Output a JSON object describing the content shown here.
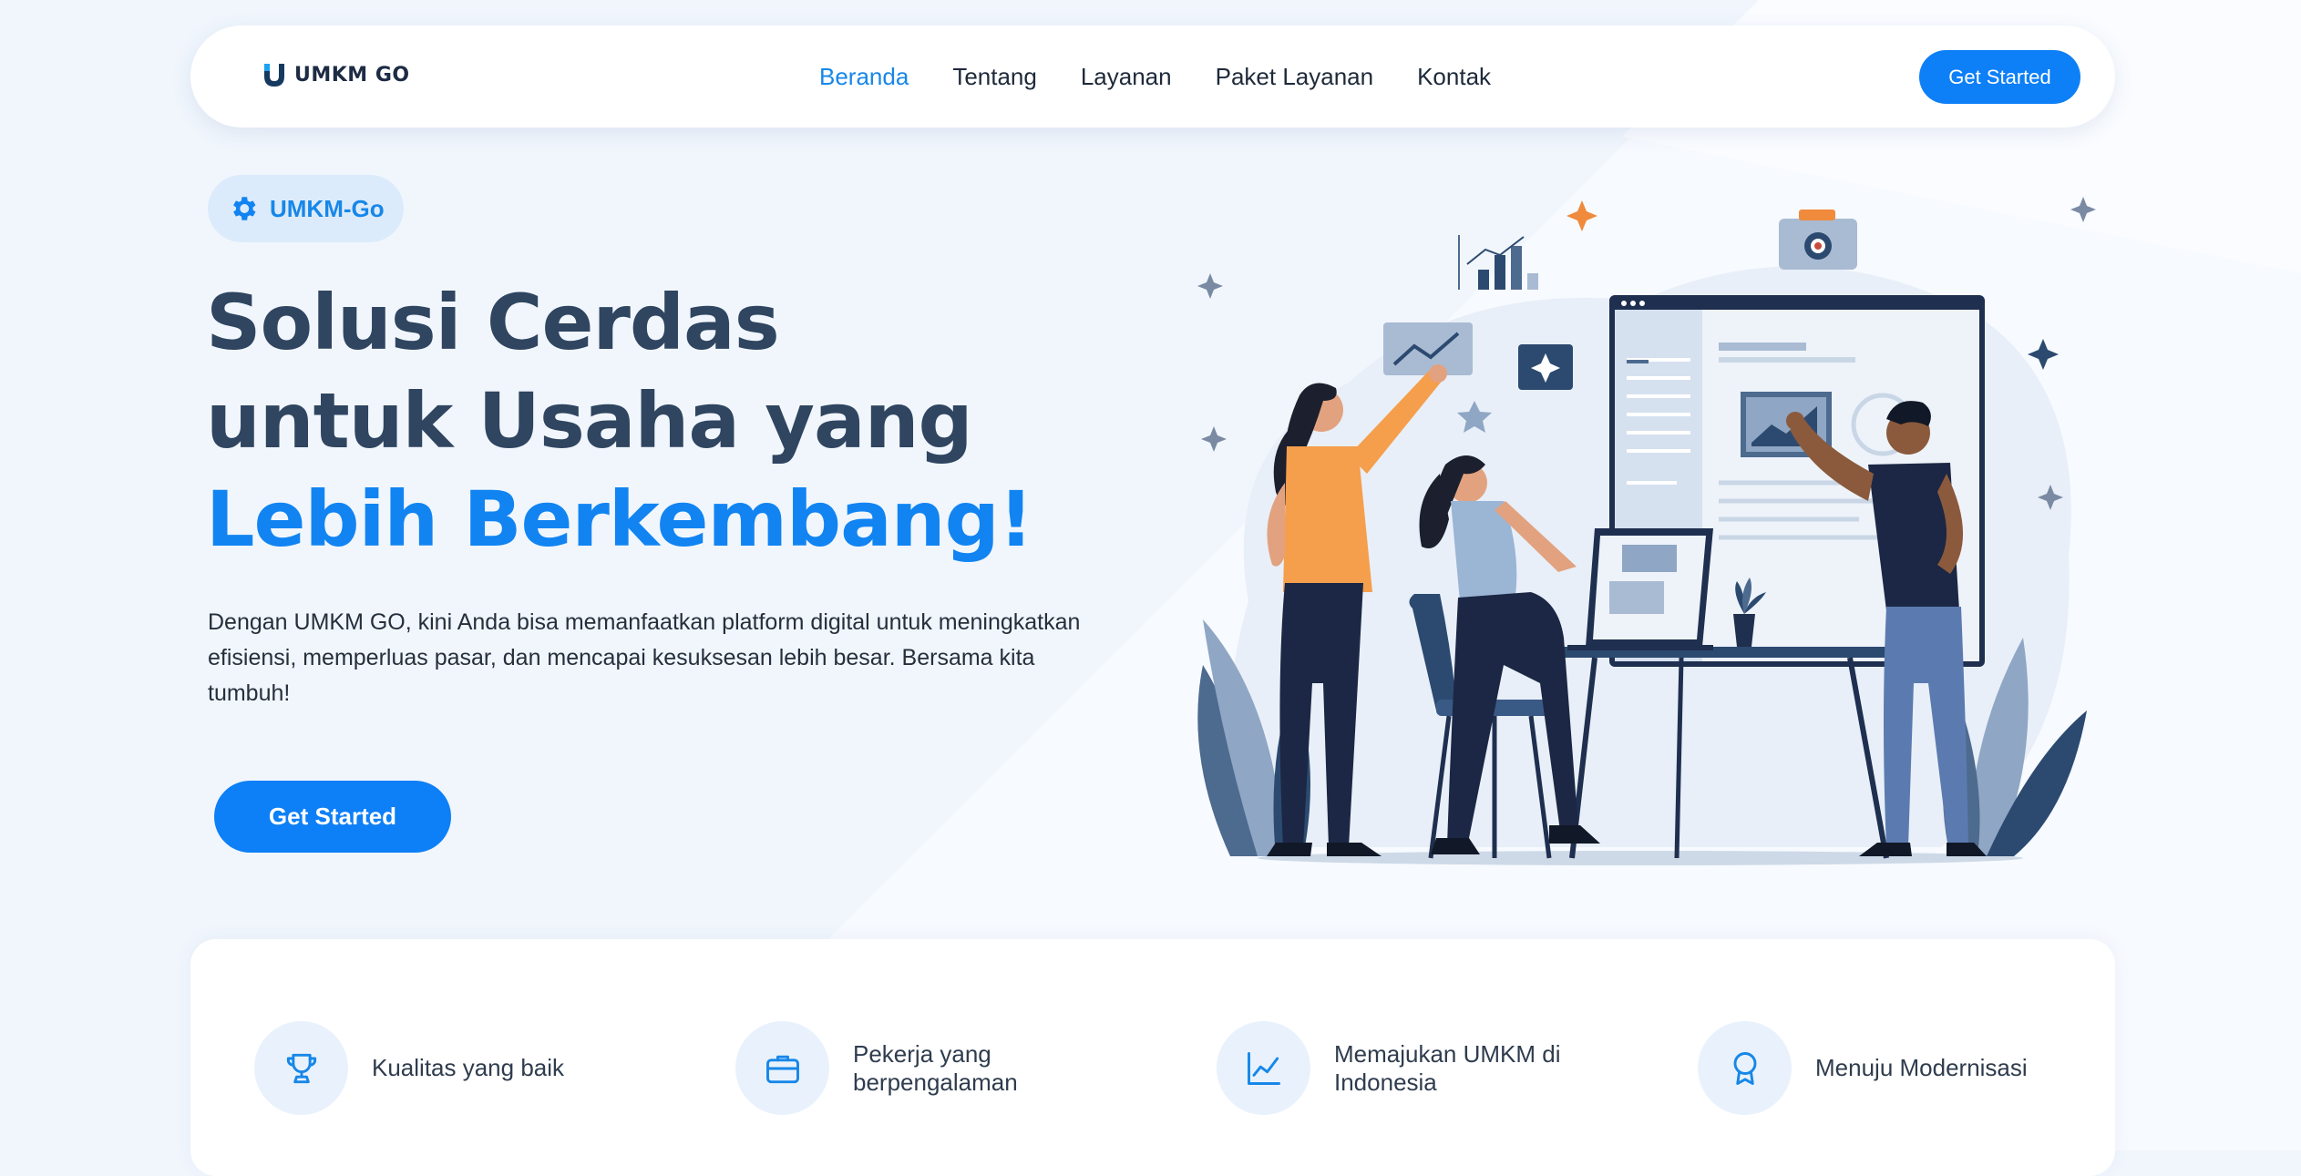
{
  "brand": {
    "name": "UMKM GO",
    "primary_color": "#0d7ff7",
    "accent_text_color": "#1184f2",
    "dark_text_color": "#2f4560",
    "background_color": "#f1f6fd"
  },
  "nav": {
    "items": [
      {
        "label": "Beranda",
        "active": true
      },
      {
        "label": "Tentang",
        "active": false
      },
      {
        "label": "Layanan",
        "active": false
      },
      {
        "label": "Paket Layanan",
        "active": false
      },
      {
        "label": "Kontak",
        "active": false
      }
    ],
    "cta_label": "Get Started"
  },
  "hero": {
    "badge": {
      "icon": "gear-icon",
      "label": "UMKM-Go"
    },
    "title_line1": "Solusi Cerdas",
    "title_line2": "untuk Usaha yang",
    "title_line3": "Lebih Berkembang!",
    "description": "Dengan UMKM GO, kini Anda bisa memanfaatkan platform digital untuk meningkatkan efisiensi, memperluas pasar, dan mencapai kesuksesan lebih besar. Bersama kita tumbuh!",
    "cta_label": "Get Started"
  },
  "features": [
    {
      "icon": "trophy-icon",
      "label": "Kualitas yang baik"
    },
    {
      "icon": "briefcase-icon",
      "label": "Pekerja yang berpengalaman"
    },
    {
      "icon": "line-chart-icon",
      "label": "Memajukan UMKM di Indonesia"
    },
    {
      "icon": "award-badge-icon",
      "label": "Menuju Modernisasi"
    }
  ]
}
